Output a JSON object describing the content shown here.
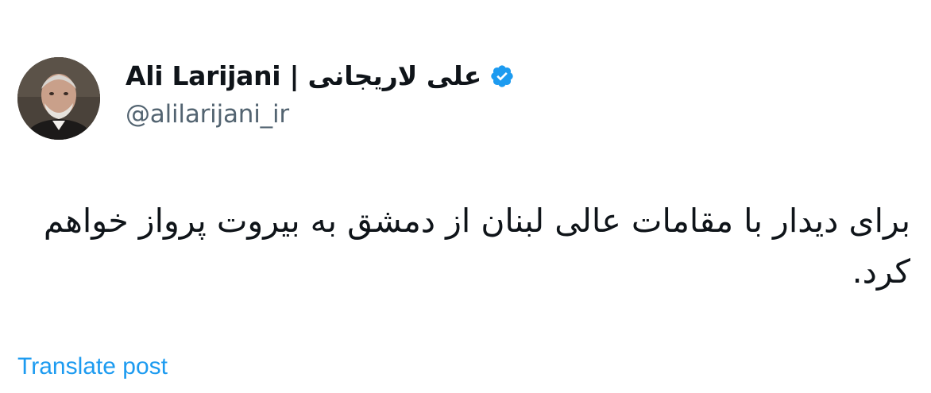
{
  "author": {
    "display_name": "Ali Larijani | علی لاریجانی",
    "handle": "@alilarijani_ir",
    "verified": true
  },
  "post": {
    "text": "برای دیدار با مقامات عالی لبنان از دمشق به بیروت پرواز خواهم کرد."
  },
  "actions": {
    "translate_label": "Translate post"
  },
  "colors": {
    "verified_badge": "#1d9bf0",
    "link": "#1d9bf0",
    "handle": "#536471",
    "text": "#0f1419"
  }
}
